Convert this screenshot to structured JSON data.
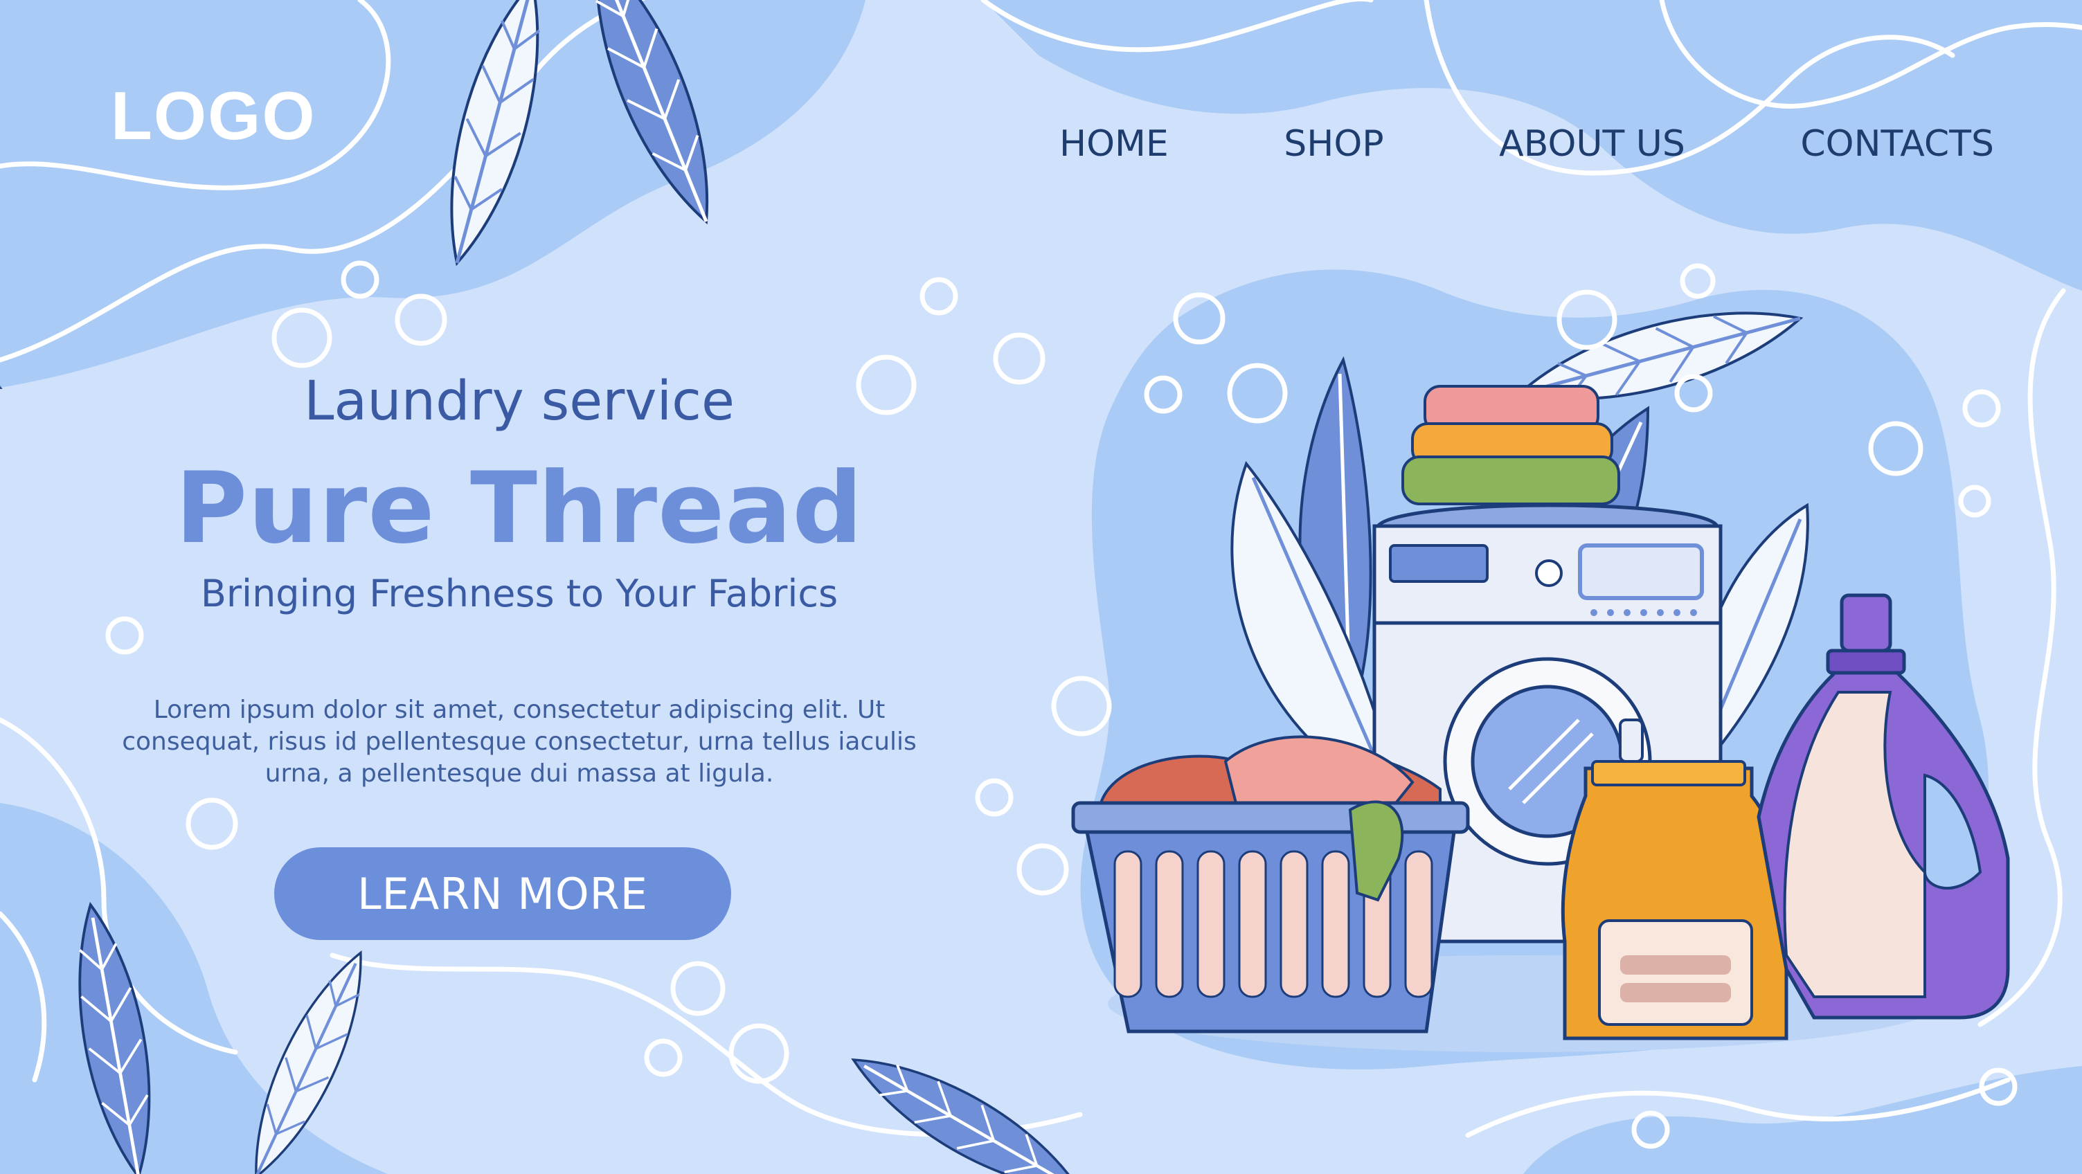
{
  "header": {
    "logo_text": "LOGO",
    "nav": [
      {
        "label": "HOME"
      },
      {
        "label": "SHOP"
      },
      {
        "label": "ABOUT US"
      },
      {
        "label": "CONTACTS"
      }
    ]
  },
  "hero": {
    "subtitle": "Laundry service",
    "title": "Pure Thread",
    "tagline": "Bringing Freshness to Your Fabrics",
    "body": "Lorem ipsum dolor sit amet, consectetur adipiscing elit. Ut consequat, risus id pellentesque consectetur, urna tellus iaculis urna, a pellentesque dui massa at ligula.",
    "cta_label": "LEARN MORE"
  },
  "illustration": {
    "items": [
      "washing-machine",
      "folded-clothes",
      "laundry-basket",
      "detergent-box",
      "detergent-bottle",
      "leaves",
      "bubbles"
    ]
  },
  "colors": {
    "background": "#cfe1fb",
    "blob": "#a9cbf5",
    "accent": "#6b8fdb",
    "nav_text": "#1f3c6e",
    "heading_text": "#3a5ba3",
    "leaf_blue": "#6f90d9",
    "detergent_orange": "#f0a32c",
    "bottle_purple": "#8c68d6"
  }
}
